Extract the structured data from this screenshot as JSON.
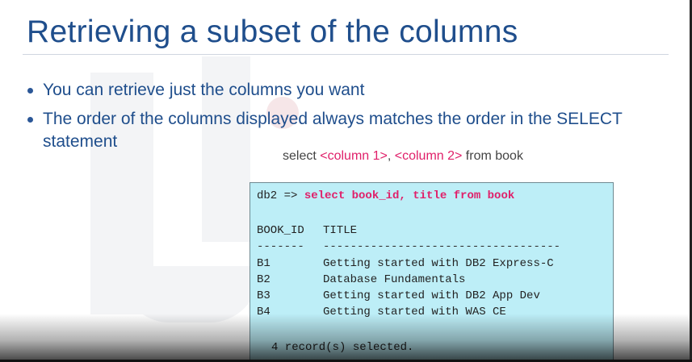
{
  "slide": {
    "title": "Retrieving a subset of the columns",
    "bullets": [
      "You can retrieve just the columns you want",
      "The order of the columns displayed always matches the order in the SELECT statement"
    ],
    "syntax": {
      "prefix": "select ",
      "col1": "<column 1>",
      "separator": ", ",
      "col2": "<column 2>",
      "suffix": " from book"
    }
  },
  "terminal": {
    "prompt": "db2 => ",
    "command": "select book_id, title from book",
    "headers": [
      "BOOK_ID",
      "TITLE"
    ],
    "header_underline": [
      "-------",
      "-----------------------------------"
    ],
    "rows": [
      {
        "book_id": "B1",
        "title": "Getting started with DB2 Express-C"
      },
      {
        "book_id": "B2",
        "title": "Database Fundamentals"
      },
      {
        "book_id": "B3",
        "title": "Getting started with DB2 App Dev"
      },
      {
        "book_id": "B4",
        "title": "Getting started with WAS CE"
      }
    ],
    "footer": "4 record(s) selected."
  },
  "colors": {
    "title": "#1f4e8c",
    "placeholder": "#e0206a",
    "terminal_bg": "#bdeef7",
    "command": "#e0206a"
  }
}
